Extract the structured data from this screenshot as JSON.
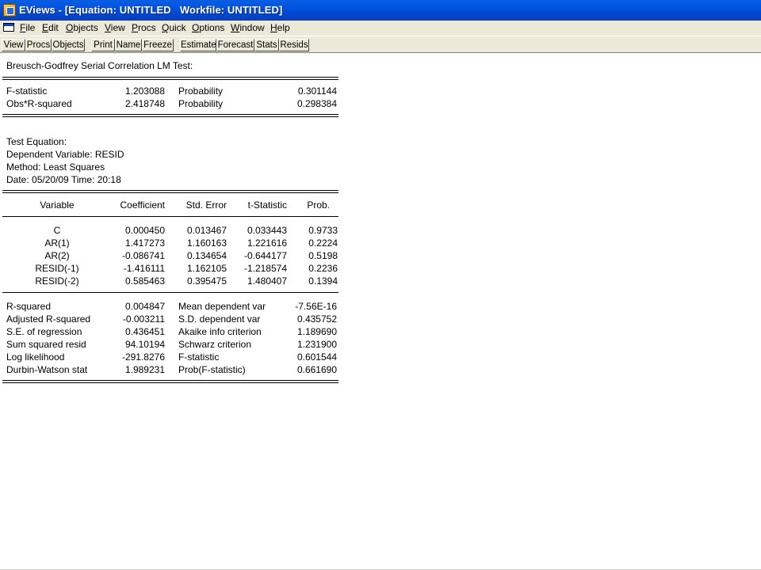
{
  "window": {
    "title": "EViews - [Equation: UNTITLED   Workfile: UNTITLED]"
  },
  "menu": {
    "items": [
      {
        "ul": "F",
        "rest": "ile"
      },
      {
        "ul": "E",
        "rest": "dit"
      },
      {
        "ul": "O",
        "rest": "bjects"
      },
      {
        "ul": "V",
        "rest": "iew"
      },
      {
        "ul": "P",
        "rest": "rocs"
      },
      {
        "ul": "Q",
        "rest": "uick"
      },
      {
        "ul": "O",
        "rest": "ptions"
      },
      {
        "ul": "W",
        "rest": "indow"
      },
      {
        "ul": "H",
        "rest": "elp"
      }
    ]
  },
  "toolbar": {
    "buttons": [
      "View",
      "Procs",
      "Objects",
      "Print",
      "Name",
      "Freeze",
      "Estimate",
      "Forecast",
      "Stats",
      "Resids"
    ]
  },
  "output": {
    "test_title": "Breusch-Godfrey Serial Correlation LM Test:",
    "summary": [
      {
        "label": "F-statistic",
        "value": "1.203088",
        "plabel": "Probability",
        "pvalue": "0.301144"
      },
      {
        "label": "Obs*R-squared",
        "value": "2.418748",
        "plabel": "Probability",
        "pvalue": "0.298384"
      }
    ],
    "info": [
      "Test Equation:",
      "Dependent Variable: RESID",
      "Method: Least Squares",
      "Date: 05/20/09   Time: 20:18"
    ],
    "headers": [
      "Variable",
      "Coefficient",
      "Std. Error",
      "t-Statistic",
      "Prob."
    ],
    "rows": [
      [
        "C",
        "0.000450",
        "0.013467",
        "0.033443",
        "0.9733"
      ],
      [
        "AR(1)",
        "1.417273",
        "1.160163",
        "1.221616",
        "0.2224"
      ],
      [
        "AR(2)",
        "-0.086741",
        "0.134654",
        "-0.644177",
        "0.5198"
      ],
      [
        "RESID(-1)",
        "-1.416111",
        "1.162105",
        "-1.218574",
        "0.2236"
      ],
      [
        "RESID(-2)",
        "0.585463",
        "0.395475",
        "1.480407",
        "0.1394"
      ]
    ],
    "stats": [
      [
        "R-squared",
        "0.004847",
        "Mean dependent var",
        "-7.56E-16"
      ],
      [
        "Adjusted R-squared",
        "-0.003211",
        "S.D. dependent var",
        "0.435752"
      ],
      [
        "S.E. of regression",
        "0.436451",
        "Akaike info criterion",
        "1.189690"
      ],
      [
        "Sum squared resid",
        "94.10194",
        "Schwarz criterion",
        "1.231900"
      ],
      [
        "Log likelihood",
        "-291.8276",
        "F-statistic",
        "0.601544"
      ],
      [
        "Durbin-Watson stat",
        "1.989231",
        "Prob(F-statistic)",
        "0.661690"
      ]
    ]
  }
}
